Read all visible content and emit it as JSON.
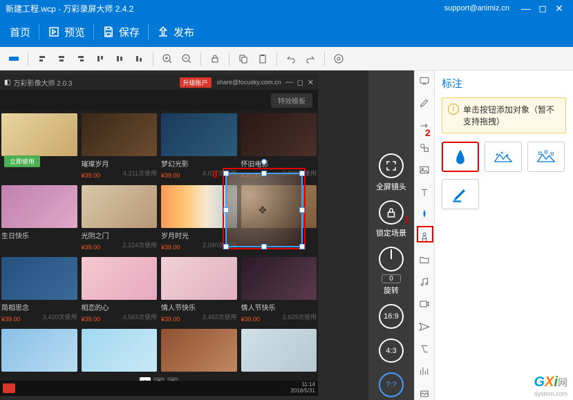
{
  "titlebar": {
    "filename": "新建工程.wcp - 万彩录屏大师 2.4.2",
    "support": "support@animiz.cn"
  },
  "menubar": {
    "home": "首页",
    "preview": "预览",
    "save": "保存",
    "publish": "发布"
  },
  "innerapp": {
    "title": "万彩影像大师 2.0.3",
    "upgrade": "升级账户",
    "email": "share@focusky.com.cn",
    "tab": "特效模板",
    "clock_time": "11:14",
    "clock_date": "2018/5/31"
  },
  "cards": [
    {
      "title": "",
      "price": "",
      "use": "",
      "btn": "立即使用"
    },
    {
      "title": "璀璨岁月",
      "price": "¥39.00",
      "use": "4,211次使用"
    },
    {
      "title": "梦幻光影",
      "price": "¥39.00",
      "use": "4,017次使用"
    },
    {
      "title": "怀旧电影",
      "price": "¥39.00",
      "use": "2,832次使用"
    },
    {
      "title": "生日快乐",
      "price": "",
      "use": ""
    },
    {
      "title": "光阴之门",
      "price": "¥39.00",
      "use": "2,224次使用"
    },
    {
      "title": "岁月时光",
      "price": "¥39.00",
      "use": "2,090次使用"
    },
    {
      "title": "",
      "price": "",
      "use": ""
    },
    {
      "title": "简相思念",
      "price": "¥39.00",
      "use": "3,420次使用"
    },
    {
      "title": "相恋的心",
      "price": "¥39.00",
      "use": "4,563次使用"
    },
    {
      "title": "情人节快乐",
      "price": "¥39.00",
      "use": "3,492次使用"
    },
    {
      "title": "情人节快乐",
      "price": "¥39.00",
      "use": "3,629次使用"
    },
    {
      "title": "",
      "price": "",
      "use": ""
    },
    {
      "title": "",
      "price": "",
      "use": ""
    },
    {
      "title": "",
      "price": "",
      "use": ""
    },
    {
      "title": "",
      "price": "",
      "use": ""
    }
  ],
  "pages": [
    "1",
    "2",
    "3"
  ],
  "controls": {
    "fullscreen": "全屏镜头",
    "lock": "锁定场景",
    "rotate": "旋转",
    "rotate_val": "0",
    "ratio1": "16:9",
    "ratio2": "4:3",
    "ratio3": "?:?"
  },
  "rightpanel": {
    "title": "标注",
    "hint": "单击按钮添加对象（暂不支持拖拽）"
  },
  "annotations": {
    "n1": "1",
    "n2": "2",
    "n3": "3"
  },
  "watermark": {
    "g": "G",
    "x": "X",
    "i": "i",
    "txt": "网",
    "domain": "system.com"
  }
}
